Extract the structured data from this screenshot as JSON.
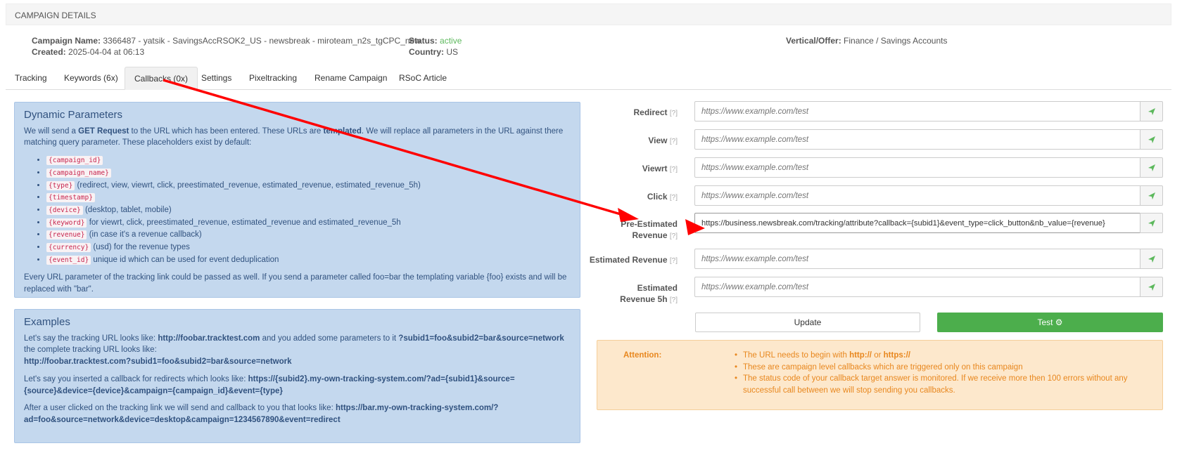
{
  "header": {
    "title": "CAMPAIGN DETAILS"
  },
  "meta": {
    "campaign_name_label": "Campaign Name:",
    "campaign_name": "3366487 - yatsik - SavingsAccRSOK2_US - newsbreak - miroteam_n2s_tgCPC_new",
    "created_label": "Created:",
    "created": "2025-04-04 at 06:13",
    "status_label": "Status:",
    "status": "active",
    "country_label": "Country:",
    "country": "US",
    "vertical_label": "Vertical/Offer:",
    "vertical": "Finance / Savings Accounts"
  },
  "tabs": [
    {
      "label": "Tracking"
    },
    {
      "label": "Keywords (6x)"
    },
    {
      "label": "Callbacks (0x)"
    },
    {
      "label": "Settings"
    },
    {
      "label": "Pixeltracking"
    },
    {
      "label": "Rename Campaign"
    },
    {
      "label": "RSoC Article"
    }
  ],
  "dynamic": {
    "title": "Dynamic Parameters",
    "intro_1": "We will send a ",
    "intro_bold_1": "GET Request",
    "intro_2": " to the URL which has been entered. These URLs are ",
    "intro_bold_2": "templated",
    "intro_3": ". We will replace all parameters in the URL against there matching query parameter. These placeholders exist by default:",
    "params": [
      {
        "code": "{campaign_id}",
        "desc": ""
      },
      {
        "code": "{campaign_name}",
        "desc": ""
      },
      {
        "code": "{type}",
        "desc": "(redirect, view, viewrt, click, preestimated_revenue, estimated_revenue, estimated_revenue_5h)"
      },
      {
        "code": "{timestamp}",
        "desc": ""
      },
      {
        "code": "{device}",
        "desc": "(desktop, tablet, mobile)"
      },
      {
        "code": "{keyword}",
        "desc": "for viewrt, click, preestimated_revenue, estimated_revenue and estimated_revenue_5h"
      },
      {
        "code": "{revenue}",
        "desc": "(in case it's a revenue callback)"
      },
      {
        "code": "{currency}",
        "desc": "(usd) for the revenue types"
      },
      {
        "code": "{event_id}",
        "desc": "unique id which can be used for event deduplication"
      }
    ],
    "footer": "Every URL parameter of the tracking link could be passed as well. If you send a parameter called foo=bar the templating variable {foo} exists and will be replaced with \"bar\"."
  },
  "examples": {
    "title": "Examples",
    "ex1_a": "Let's say the tracking URL looks like: ",
    "ex1_b": "http://foobar.tracktest.com",
    "ex1_c": " and you added some parameters to it ",
    "ex1_d": "?subid1=foo&subid2=bar&source=network",
    "ex1_e": " the complete tracking URL looks like:",
    "ex1_f": "http://foobar.tracktest.com?subid1=foo&subid2=bar&source=network",
    "ex2_a": "Let's say you inserted a callback for redirects which looks like: ",
    "ex2_b": "https://{subid2}.my-own-tracking-system.com/?ad={subid1}&source={source}&device={device}&campaign={campaign_id}&event={type}",
    "ex3_a": "After a user clicked on the tracking link we will send and callback to you that looks like: ",
    "ex3_b": "https://bar.my-own-tracking-system.com/?ad=foo&source=network&device=desktop&campaign=1234567890&event=redirect"
  },
  "form": {
    "help": "[?]",
    "placeholder": "https://www.example.com/test",
    "rows": [
      {
        "label": "Redirect",
        "value": ""
      },
      {
        "label": "View",
        "value": ""
      },
      {
        "label": "Viewrt",
        "value": ""
      },
      {
        "label": "Click",
        "value": ""
      },
      {
        "label": "Pre-Estimated Revenue",
        "value": "https://business.newsbreak.com/tracking/attribute?callback={subid1}&event_type=click_button&nb_value={revenue}"
      },
      {
        "label": "Estimated Revenue",
        "value": ""
      },
      {
        "label": "Estimated Revenue 5h",
        "value": ""
      }
    ],
    "update_label": "Update",
    "test_label": "Test"
  },
  "attention": {
    "label": "Attention:",
    "item1_a": "The URL needs to begin with ",
    "item1_b": "http://",
    "item1_c": " or ",
    "item1_d": "https://",
    "item2": "These are campaign level callbacks which are triggered only on this campaign",
    "item3": "The status code of your callback target answer is monitored. If we receive more then 100 errors without any successful call between we will stop sending you callbacks."
  },
  "colors": {
    "send_icon": "#5cb85c",
    "annotation_arrow": "#ff0000"
  }
}
